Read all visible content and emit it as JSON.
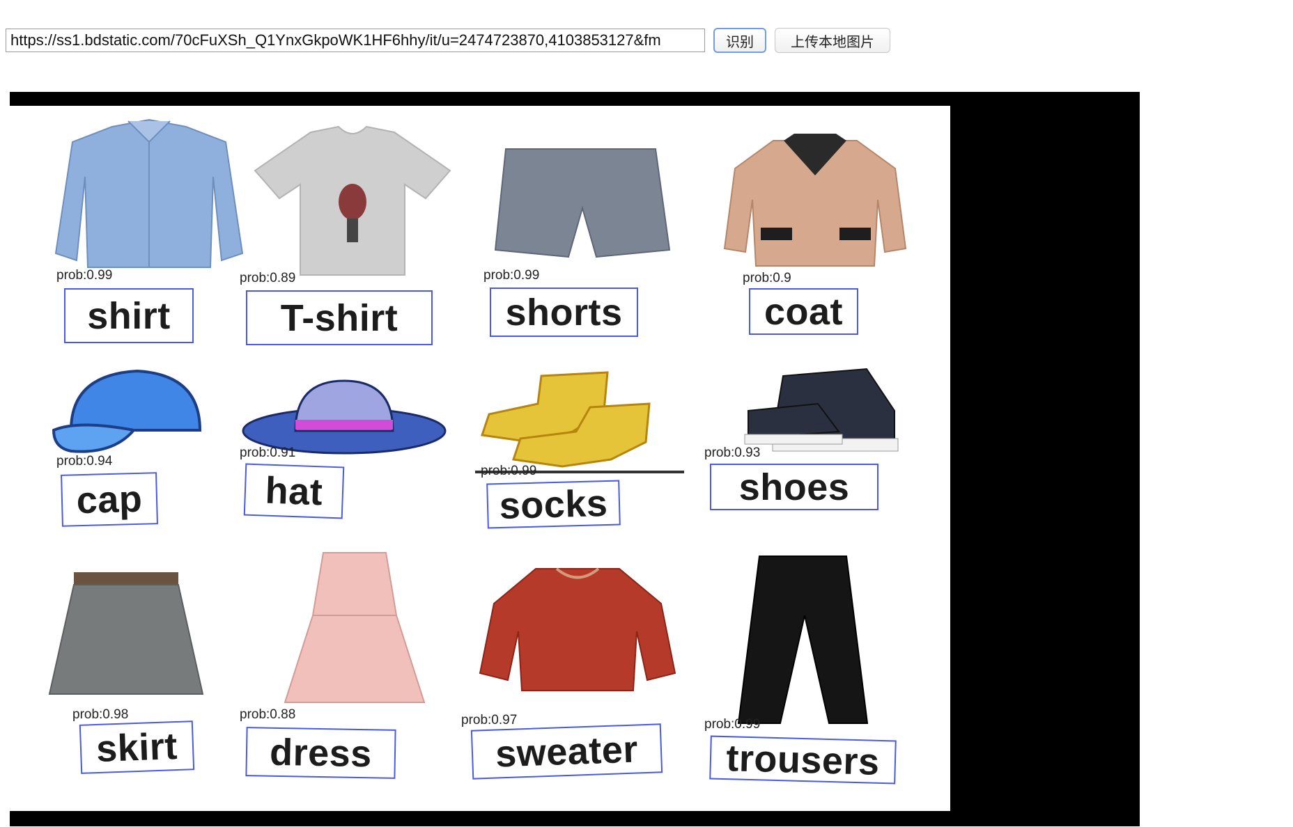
{
  "toolbar": {
    "url_value": "https://ss1.bdstatic.com/70cFuXSh_Q1YnxGkpoWK1HF6hhy/it/u=2474723870,4103853127&fm",
    "recognize_label": "识别",
    "upload_label": "上传本地图片"
  },
  "detections": [
    {
      "label": "shirt",
      "prob": "prob:0.99",
      "icon": "shirt-icon",
      "color": "#8fb0dc"
    },
    {
      "label": "T-shirt",
      "prob": "prob:0.89",
      "icon": "tshirt-icon",
      "color": "#cfcfcf"
    },
    {
      "label": "shorts",
      "prob": "prob:0.99",
      "icon": "shorts-icon",
      "color": "#7c8594"
    },
    {
      "label": "coat",
      "prob": "prob:0.9",
      "icon": "coat-icon",
      "color": "#d6a88e"
    },
    {
      "label": "cap",
      "prob": "prob:0.94",
      "icon": "cap-icon",
      "color": "#3f86e6"
    },
    {
      "label": "hat",
      "prob": "prob:0.91",
      "icon": "hat-icon",
      "color": "#3f5fbf"
    },
    {
      "label": "socks",
      "prob": "prob:0.99",
      "icon": "socks-icon",
      "color": "#e6c43a"
    },
    {
      "label": "shoes",
      "prob": "prob:0.93",
      "icon": "shoes-icon",
      "color": "#2a3040"
    },
    {
      "label": "skirt",
      "prob": "prob:0.98",
      "icon": "skirt-icon",
      "color": "#777b7c"
    },
    {
      "label": "dress",
      "prob": "prob:0.88",
      "icon": "dress-icon",
      "color": "#f1c0bb"
    },
    {
      "label": "sweater",
      "prob": "prob:0.97",
      "icon": "sweater-icon",
      "color": "#b53a2a"
    },
    {
      "label": "trousers",
      "prob": "prob:0.99",
      "icon": "trousers-icon",
      "color": "#151515"
    }
  ],
  "colors": {
    "box_border": "#4a5ae0",
    "frame_background": "#000000",
    "button_focus": "#6f9de0"
  }
}
